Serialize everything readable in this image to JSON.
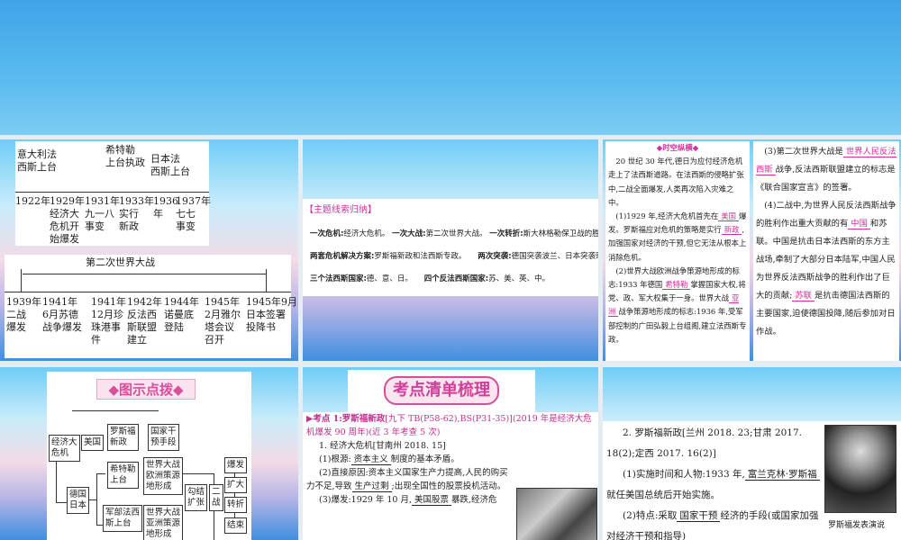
{
  "slide1": {
    "top_events": [
      "意大利法\n西斯上台",
      "希特勒\n上台执政",
      "日本法\n西斯上台"
    ],
    "top_years": [
      "1922年",
      "1929年\n经济大\n危机开\n始爆发",
      "1931年\n九一八\n事变",
      "1933年\n实行\n新政",
      "1936\n年",
      "1937年\n七七\n事变"
    ],
    "ww2_label": "第二次世界大战",
    "bottom_years": [
      "1939年\n二战\n爆发",
      "1941年\n6月苏德\n战争爆发",
      "1941年\n12月珍\n珠港事\n件",
      "1942年\n反法西\n斯联盟\n建立",
      "1944年\n诺曼底\n登陆",
      "1945年\n2月雅尔\n塔会议\n召开",
      "1945年9月\n日本签署\n投降书"
    ]
  },
  "slide2": {
    "heading": "【主题线索归纳】",
    "rows": [
      [
        {
          "k": "一次危机:",
          "v": "经济大危机。"
        },
        {
          "k": "一次大战:",
          "v": "第二次世界大战。"
        },
        {
          "k": "一次转折:",
          "v": "斯大林格勒保卫战的胜利。"
        }
      ],
      [
        {
          "k": "两套危机解决方案:",
          "v": "罗斯福新政和法西斯专政。"
        },
        {
          "k": "两次突袭:",
          "v": "德国突袭波兰、日本突袭珍珠港。"
        }
      ],
      [
        {
          "k": "三个法西斯国家:",
          "v": "德、意、日。"
        },
        {
          "k": "四个反法西斯国家:",
          "v": "苏、美、英、中。"
        }
      ]
    ]
  },
  "slide3": {
    "title": "◆时空纵横◆",
    "left_text": "　20 世纪 30 年代,德日为应付经济危机走上了法西斯道路。在法西斯的侵略扩张中,二战全面爆发,人类再次陷入灾难之中。",
    "q1_a": "　(1)1929 年,经济大危机首先在",
    "q1_b1": "美国",
    "q1_c": "爆发。罗斯福应对危机的策略是实行",
    "q1_b2": "新政",
    "q1_d": ",加强国家对经济的干预,但它无法从根本上消除危机。",
    "q2_a": "　(2)世界大战欧洲战争策源地形成的标志:1933 年德国",
    "q2_b1": "希特勒",
    "q2_c": "掌握国家大权,将党、政、军大权集于一身。世界大战",
    "q2_b2": "亚洲",
    "q2_d": "战争策源地形成的标志:1936 年,受军部控制的广田弘毅上台组阁,建立法西斯专政。",
    "q3_a": "　(3)第二次世界大战是",
    "q3_b1": "世界人民反法西斯",
    "q3_c": "战争,反法西斯联盟建立的标志是《联合国家宣言》的签署。",
    "q4_a": "　(4)二战中,为世界人民反法西斯战争的胜利作出重大贡献的有",
    "q4_b1": "中国",
    "q4_c": "和苏联。中国是抗击日本法西斯的东方主战场,牵制了大部分日本陆军,中国人民为世界反法西斯战争的胜利作出了巨大的贡献;",
    "q4_b2": "苏联",
    "q4_d": "是抗击德国法西斯的主要国家,迫使德国投降,随后参加对日作战。"
  },
  "slide4": {
    "title": "◆图示点拨◆",
    "boxes": {
      "crisis": "经济大\n危机",
      "usa": "美国",
      "newdeal": "罗斯福\n新政",
      "intervene": "国家干\n预手段",
      "ger_jp": "德国\n日本",
      "hitler": "希特勒\n上台",
      "military": "军部法西\n斯上台",
      "eu_src": "世界大战\n欧洲策源\n地形成",
      "as_src": "世界大战\n亚洲策源\n地形成",
      "collude": "勾结\n扩张",
      "ww2": "二\n战",
      "s1": "爆发",
      "s2": "扩大",
      "s3": "转折",
      "s4": "结束"
    }
  },
  "slide5": {
    "banner": "考点清单梳理",
    "kp_title": "考点 1:罗斯福新政",
    "kp_ref": "[九下 TB(P58-62),BS(P31-35)](2019 年是经济大危机爆发 90 周年)(近 3 年考查 5 次)",
    "h1": "1. 经济大危机[甘南州 2018. 15]",
    "l1a": "(1)根源:",
    "l1b": "资本主义",
    "l1c": "制度的基本矛盾。",
    "l2a": "(2)直接原因:资本主义国家生产力提高,人民的购买力不足,导致",
    "l2b": "生产过剩",
    "l2c": ";出现全国性的股票投机活动。",
    "l3a": "(3)爆发:1929 年 10 月,",
    "l3b": "美国股票",
    "l3c": "暴跌,经济危"
  },
  "slide6": {
    "h2": "2. 罗斯福新政[兰州 2018. 23;甘肃 2017. 18(2);定西 2017. 16(2)]",
    "l1a": "(1)实施时间和人物:1933 年,",
    "l1b": "富兰克林·罗斯福",
    "l1c": "就任美国总统后开始实施。",
    "l2a": "(2)特点:采取",
    "l2b": "国家干预",
    "l2c": "经济的手段(或国家加强对经济干预和指导)",
    "caption": "罗斯福发表演说"
  }
}
